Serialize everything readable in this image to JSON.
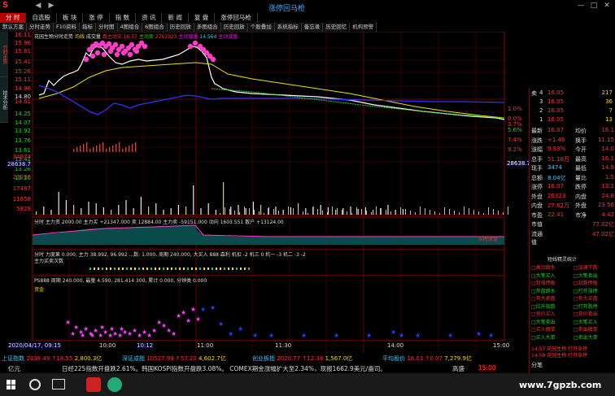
{
  "window": {
    "title": "涨停回马枪"
  },
  "menu": [
    "分  时",
    "自选股",
    "板  块",
    "涨  停",
    "指  数",
    "资  讯",
    "新  闻",
    "复  盘",
    "涨停回马枪"
  ],
  "toolbar": [
    "默认方案",
    "分时走势",
    "F10资料",
    "指标",
    "分时图",
    "4图组合",
    "6图组合",
    "历史回放",
    "多图组合",
    "历史回放",
    "个股叠加",
    "系统指标",
    "备忘录",
    "历史回忆",
    "机构预警"
  ],
  "left_tabs": [
    "分时走势",
    "技术分析"
  ],
  "chart_header": {
    "text": "花园生物分时走势",
    "legend": [
      "均线",
      "成交量",
      "真主动买",
      "主动卖",
      "主动增量",
      "主动减量",
      "涨主动增量"
    ],
    "legend_vals": [
      "16.37",
      "2761923",
      "276192",
      "14.564",
      "21.68"
    ]
  },
  "price_labels_left": [
    "16.11",
    "15.96",
    "15.61",
    "15.41",
    "15.26",
    "15.11",
    "14.96",
    "14.80",
    "14.61",
    "14.25",
    "14.07",
    "13.92",
    "13.76",
    "13.61",
    "13.41",
    "13.26",
    "13.10"
  ],
  "price_labels_right": [
    "1.0%",
    "0.0%",
    "3.7%",
    "5.6%",
    "7.4%",
    "9.2%"
  ],
  "vol_labels": [
    "34974",
    "28638.7",
    "23206",
    "17487",
    "11658",
    "5829"
  ],
  "vol_right": "28638.7",
  "time_labels": [
    "2020/04/17, 09:15",
    "10:00",
    "10:12",
    "11:00",
    "11:30",
    "14:00",
    "15:00"
  ],
  "sub1": {
    "legend": "分时  主力资  2000.00  主力买  +21347.000  卖  12884.00  主力卖  -59151.000  动向  1603.551  散户  +13124.00",
    "label": "实时资金"
  },
  "sub2": {
    "legend": "分时 力度果 0.000, 主力 38.992, 96.992 ...数: 1.000, 周期 240.000, 大买入 888 森利 机扣 -2 机三 0 机一 -3 机二 -3 -2",
    "label": "主力买卖次数"
  },
  "sub3": {
    "legend": "PS888  周期 240.000, 最量 4.590, 281.414 300, 累计 0.000, 分钟类 0.000",
    "label": "资金"
  },
  "right_panel": {
    "orderbook": [
      {
        "side": "卖",
        "lvl": "4",
        "price": "16.05",
        "vol": "217"
      },
      {
        "side": "",
        "lvl": "3",
        "price": "16.05",
        "vol": "36"
      },
      {
        "side": "",
        "lvl": "2",
        "price": "16.05",
        "vol": "7"
      },
      {
        "side": "",
        "lvl": "1",
        "price": "16.05",
        "vol": "13"
      }
    ],
    "stats": [
      {
        "k1": "最新",
        "v1": "16.07",
        "k2": "均价",
        "v2": "16.1"
      },
      {
        "k1": "涨跌",
        "v1": "+1.46",
        "k2": "换手",
        "v2": "11.15"
      },
      {
        "k1": "涨幅",
        "v1": "9.93%",
        "k2": "今开",
        "v2": "14.0"
      },
      {
        "k1": "总手",
        "v1": "51.18万",
        "k2": "最高",
        "v2": "16.1"
      },
      {
        "k1": "现手",
        "v1": "3474",
        "k2": "最低",
        "v2": "14.9"
      },
      {
        "k1": "总额",
        "v1": "8.04亿",
        "k2": "量比",
        "v2": "1.5"
      },
      {
        "k1": "涨停",
        "v1": "16.07",
        "k2": "跌停",
        "v2": "13.1"
      },
      {
        "k1": "外盘",
        "v1": "26323",
        "k2": "内盘",
        "v2": "24.8"
      },
      {
        "k1": "内盘",
        "v1": "27.62万",
        "k2": "外盘",
        "v2": "23.56"
      },
      {
        "k1": "市盈",
        "v1": "22.41",
        "k2": "市净",
        "v2": "4.42"
      },
      {
        "k1": "市值",
        "v1": "",
        "k2": "",
        "v2": "77.02亿"
      },
      {
        "k1": "流通值",
        "v1": "",
        "k2": "",
        "v2": "47.02亿"
      }
    ],
    "sector_title": "短线精灵统计",
    "sectors": [
      "高台跳水",
      "大笔买入",
      "封涨停板",
      "开盘跳水",
      "有大卖盘",
      "拉升指数",
      "竞价买入",
      "大笔卖出",
      "买入撤单",
      "买入大单",
      "加速下跌",
      "大笔卖出",
      "封跌停板",
      "打开涨停",
      "有大买盘",
      "打开跌停",
      "竞价卖出",
      "大笔买入",
      "卖出撤单",
      "卖出大单"
    ],
    "ticker_items": [
      "14:57 花园生物 打开涨停",
      "14:58 花园生物 打开涨停"
    ],
    "bottom_tab": "分笔"
  },
  "index_bar": [
    {
      "name": "上证指数",
      "val": "2838.49",
      "chg": "↑18.55",
      "amt": "2,800.3亿"
    },
    {
      "name": "深证成指",
      "val": "10527.99",
      "chg": "↑57.20",
      "amt": "4,602.7亿"
    },
    {
      "name": "创业板指",
      "val": "2020.77",
      "chg": "↑12.38",
      "amt": "1,567.0亿"
    },
    {
      "name": "平均股价",
      "val": "16.03",
      "chg": "↑0.07",
      "amt": "7,279.9亿"
    }
  ],
  "ticker": "日经225指数开盘跌2.61%。韩国KOSPI指数开盘跌3.08%。    COMEX期金涨幅扩大至2.34%，现报1662.9美元/盎司。",
  "ticker_label": "高盛",
  "ticker_right": "15:00",
  "taskbar_items": [
    "亿元"
  ],
  "watermark": "www.7gpzb.com",
  "colors": {
    "up": "#ff3030",
    "down": "#19d619",
    "price_line": "#ffffff",
    "avg_line": "#e6e600",
    "bg": "#000000"
  }
}
